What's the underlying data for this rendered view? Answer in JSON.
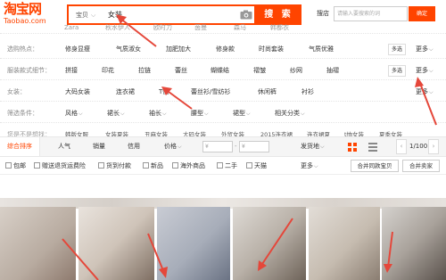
{
  "header": {
    "logo_cn": "淘宝网",
    "logo_en": "Taobao.com",
    "search_scope": "宝贝",
    "search_query": "女装",
    "search_button": "搜 索",
    "shop_label": "搜店",
    "shop_placeholder": "请输入要搜索的词",
    "confirm_button": "确定"
  },
  "row0": {
    "items": [
      "Zara",
      "秋水伊人",
      "欧时力",
      "茵曼",
      "森马",
      "韩都衣"
    ]
  },
  "filters": [
    {
      "label": "选购热点：",
      "values": [
        "修身显瘦",
        "气质淑女",
        "加肥加大",
        "修身款",
        "时尚套装",
        "气质优雅"
      ],
      "multi": "多选",
      "more": "更多"
    },
    {
      "label": "服装款式细节：",
      "values": [
        "拼接",
        "印花",
        "拉链",
        "蕾丝",
        "蝴蝶结",
        "褶皱",
        "纱网",
        "抽褶"
      ],
      "multi": "多选",
      "more": "更多"
    },
    {
      "label": "女装：",
      "values": [
        "大码女装",
        "连衣裙",
        "T恤",
        "蕾丝衫/雪纺衫",
        "休闲裤",
        "衬衫"
      ],
      "more": "更多"
    },
    {
      "label": "筛选条件：",
      "values": [
        "风格",
        "裙长",
        "袖长",
        "腰型",
        "裙型",
        "相关分类"
      ]
    }
  ],
  "related": {
    "label": "您是不是想找：",
    "items": [
      "韩版女服",
      "女装夏装",
      "丑麻女装",
      "大码女装",
      "外贸女装",
      "2015连衣裙",
      "连衣裙夏",
      "t恤女装",
      "夏季女装"
    ]
  },
  "sortbar": {
    "default": "综合排序",
    "popularity": "人气",
    "sales": "销量",
    "credit": "信用",
    "price": "价格",
    "price_min": "¥",
    "price_max": "¥",
    "ship_from": "发货地",
    "page": "1/100"
  },
  "checkbar": {
    "items": [
      "包邮",
      "赠送退货运费险",
      "货到付款",
      "新品",
      "海外商品",
      "二手",
      "天猫"
    ],
    "more": "更多",
    "merge_same": "合并同款宝贝",
    "merge_seller": "合并卖家"
  },
  "colors": {
    "brand": "#ff4400",
    "annotation_arrow": "#e5473a"
  }
}
